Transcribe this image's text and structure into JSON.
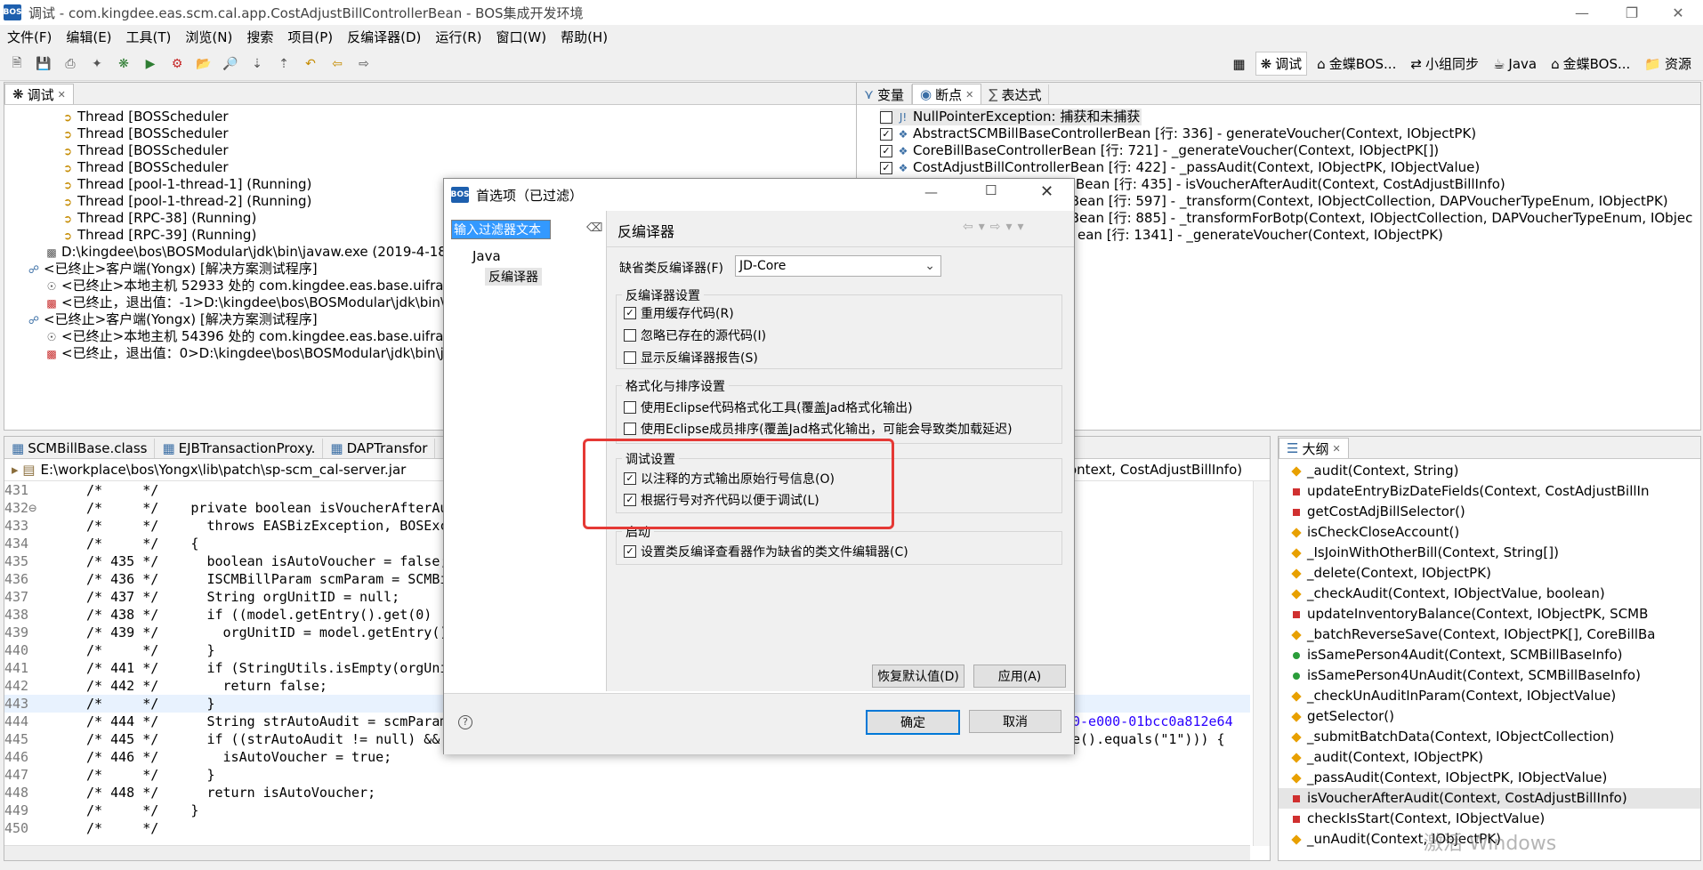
{
  "window": {
    "title": "调试 - com.kingdee.eas.scm.cal.app.CostAdjustBillControllerBean - BOS集成开发环境",
    "logo_text": "BOS"
  },
  "menu": [
    "文件(F)",
    "编辑(E)",
    "工具(T)",
    "浏览(N)",
    "搜索",
    "项目(P)",
    "反编译器(D)",
    "运行(R)",
    "窗口(W)",
    "帮助(H)"
  ],
  "perspectives": [
    "调试",
    "金蝶BOS...",
    "小组同步",
    "Java",
    "金蝶BOS...",
    "资源"
  ],
  "debug_view": {
    "tab": "调试",
    "rows": [
      "Thread [BOSScheduler",
      "Thread [BOSScheduler",
      "Thread [BOSScheduler",
      "Thread [BOSScheduler",
      "Thread [pool-1-thread-1] (Running)",
      "Thread [pool-1-thread-2] (Running)",
      "Thread [RPC-38] (Running)",
      "Thread [RPC-39] (Running)",
      "D:\\kingdee\\bos\\BOSModular\\jdk\\bin\\javaw.exe  (2019-4-18",
      "<已终止>客户端(Yongx) [解决方案测试程序]",
      "<已终止>本地主机 52933 处的 com.kingdee.eas.base.uiframe",
      "<已终止，退出值：-1>D:\\kingdee\\bos\\BOSModular\\jdk\\bin\\",
      "<已终止>客户端(Yongx) [解决方案测试程序]",
      "<已终止>本地主机 54396 处的 com.kingdee.eas.base.uiframe",
      "<已终止，退出值：0>D:\\kingdee\\bos\\BOSModular\\jdk\\bin\\j"
    ]
  },
  "breakpoints_view": {
    "tabs": [
      "变量",
      "断点",
      "表达式"
    ],
    "rows": [
      {
        "checked": false,
        "text": "NullPointerException: 捕获和未捕获"
      },
      {
        "checked": true,
        "text": "AbstractSCMBillBaseControllerBean [行:   336] - generateVoucher(Context, IObjectPK)"
      },
      {
        "checked": true,
        "text": "CoreBillBaseControllerBean [行:   721] - _generateVoucher(Context, IObjectPK[])"
      },
      {
        "checked": true,
        "text": "CostAdjustBillControllerBean [行:   422] - _passAudit(Context, IObjectPK, IObjectValue)"
      },
      {
        "checked": true,
        "text": "Bean [行:   435] - isVoucherAfterAudit(Context, CostAdjustBillInfo)"
      },
      {
        "checked": true,
        "text": "llerBean [行:   597] - _transform(Context, IObjectCollection, DAPVoucherTypeEnum, IObjectPK)"
      },
      {
        "checked": true,
        "text": "llerBean [行:   885] - _transformForBotp(Context, IObjectCollection, DAPVoucherTypeEnum, IObjec"
      },
      {
        "checked": true,
        "text": "ean [行:   1341] - _generateVoucher(Context, IObjectPK)"
      }
    ]
  },
  "editor": {
    "tabs": [
      "SCMBillBase.class",
      "EJBTransactionProxy.",
      "DAPTransfor"
    ],
    "path": "E:\\workplace\\bos\\Yongx\\lib\\patch\\sp-scm_cal-server.jar",
    "breadcrumb_tail": "ontext, CostAdjustBillInfo)",
    "lines": [
      {
        "num": "431",
        "code": "/*     */"
      },
      {
        "num": "432⊖",
        "code": "/*     */    private boolean isVoucherAfterAu"
      },
      {
        "num": "433",
        "code": "/*     */      throws EASBizException, BOSExc"
      },
      {
        "num": "434",
        "code": "/*     */    {"
      },
      {
        "num": "435",
        "code": "/* 435 */      boolean isAutoVoucher = false;"
      },
      {
        "num": "436",
        "code": "/* 436 */      ISCMBillParam scmParam = SCMBi"
      },
      {
        "num": "437",
        "code": "/* 437 */      String orgUnitID = null;"
      },
      {
        "num": "438",
        "code": "/* 438 */      if ((model.getEntry().get(0) !"
      },
      {
        "num": "439",
        "code": "/* 439 */        orgUnitID = model.getEntry()"
      },
      {
        "num": "440",
        "code": "/*     */      }"
      },
      {
        "num": "441",
        "code": "/* 441 */      if (StringUtils.isEmpty(orgUni"
      },
      {
        "num": "442",
        "code": "/* 442 */        return false;"
      },
      {
        "num": "443",
        "code": "/*     */      }"
      },
      {
        "num": "444",
        "code": "/* 444 */      String strAutoAudit = scmParam"
      },
      {
        "num": "445",
        "code": "/* 445 */      if ((strAutoAudit != null) &&"
      },
      {
        "num": "446",
        "code": "/* 446 */        isAutoVoucher = true;"
      },
      {
        "num": "447",
        "code": "/*     */      }"
      },
      {
        "num": "448",
        "code": "/* 448 */      return isAutoVoucher;"
      },
      {
        "num": "449",
        "code": "/*     */    }"
      },
      {
        "num": "450",
        "code": "/*     */"
      }
    ],
    "right_frag_444": "0-e000-01bcc0a812e64",
    "right_frag_445": "e().equals(\"1\"))) {"
  },
  "outline": {
    "tab": "大纲",
    "items": [
      {
        "mark": "diamond",
        "color": "#e8a000",
        "text": "_audit(Context, String)"
      },
      {
        "mark": "square",
        "color": "#d03030",
        "text": "updateEntryBizDateFields(Context, CostAdjustBillIn"
      },
      {
        "mark": "square",
        "color": "#d03030",
        "text": "getCostAdjBillSelector()"
      },
      {
        "mark": "diamond",
        "color": "#e8a000",
        "text": "isCheckCloseAccount()"
      },
      {
        "mark": "diamond",
        "color": "#e8a000",
        "text": "_IsJoinWithOtherBill(Context, String[])"
      },
      {
        "mark": "diamond",
        "color": "#e8a000",
        "text": "_delete(Context, IObjectPK)"
      },
      {
        "mark": "diamond",
        "color": "#e8a000",
        "text": "_checkAudit(Context, IObjectValue, boolean)"
      },
      {
        "mark": "square",
        "color": "#d03030",
        "text": "updateInventoryBalance(Context, IObjectPK, SCMB"
      },
      {
        "mark": "diamond",
        "color": "#e8a000",
        "text": "_batchReverseSave(Context, IObjectPK[], CoreBillBa"
      },
      {
        "mark": "dot",
        "color": "#2a9d3a",
        "text": "isSamePerson4Audit(Context, SCMBillBaseInfo)"
      },
      {
        "mark": "dot",
        "color": "#2a9d3a",
        "text": "isSamePerson4UnAudit(Context, SCMBillBaseInfo)"
      },
      {
        "mark": "diamond",
        "color": "#e8a000",
        "text": "_checkUnAuditInParam(Context, IObjectValue)"
      },
      {
        "mark": "diamond",
        "color": "#e8a000",
        "text": "getSelector()"
      },
      {
        "mark": "diamond",
        "color": "#e8a000",
        "text": "_submitBatchData(Context, IObjectCollection)"
      },
      {
        "mark": "diamond",
        "color": "#e8a000",
        "text": "_audit(Context, IObjectPK)"
      },
      {
        "mark": "diamond",
        "color": "#e8a000",
        "text": "_passAudit(Context, IObjectPK, IObjectValue)"
      },
      {
        "mark": "square",
        "color": "#d03030",
        "text": "isVoucherAfterAudit(Context, CostAdjustBillInfo)"
      },
      {
        "mark": "square",
        "color": "#d03030",
        "text": "checkIsStart(Context, IObjectValue)"
      },
      {
        "mark": "diamond",
        "color": "#e8a000",
        "text": "_unAudit(Context, IObjectPK)"
      }
    ]
  },
  "dialog": {
    "logo_text": "BOS",
    "title": "首选项（已过滤）",
    "filter_value": "输入过滤器文本",
    "tree": [
      "Java",
      "反编译器"
    ],
    "page_title": "反编译器",
    "default_decompiler_label": "缺省类反编译器(F)",
    "default_decompiler_value": "JD-Core",
    "groups": {
      "decompiler_settings": {
        "title": "反编译器设置",
        "options": [
          {
            "checked": true,
            "label": "重用缓存代码(R)"
          },
          {
            "checked": false,
            "label": "忽略已存在的源代码(I)"
          },
          {
            "checked": false,
            "label": "显示反编译器报告(S)"
          }
        ]
      },
      "format_settings": {
        "title": "格式化与排序设置",
        "options": [
          {
            "checked": false,
            "label": "使用Eclipse代码格式化工具(覆盖Jad格式化输出)"
          },
          {
            "checked": false,
            "label": "使用Eclipse成员排序(覆盖Jad格式化输出，可能会导致类加载延迟)"
          }
        ]
      },
      "debug_settings": {
        "title": "调试设置",
        "options": [
          {
            "checked": true,
            "label": "以注释的方式输出原始行号信息(O)"
          },
          {
            "checked": true,
            "label": "根据行号对齐代码以便于调试(L)"
          }
        ]
      },
      "startup": {
        "title": "启动",
        "options": [
          {
            "checked": true,
            "label": "设置类反编译查看器作为缺省的类文件编辑器(C)"
          }
        ]
      }
    },
    "restore_defaults": "恢复默认值(D)",
    "apply": "应用(A)",
    "ok": "确定",
    "cancel": "取消",
    "help": "?"
  },
  "colors": {
    "highlight_box": "#e53935",
    "accent": "#0078d7"
  },
  "watermark": "激活 Windows"
}
